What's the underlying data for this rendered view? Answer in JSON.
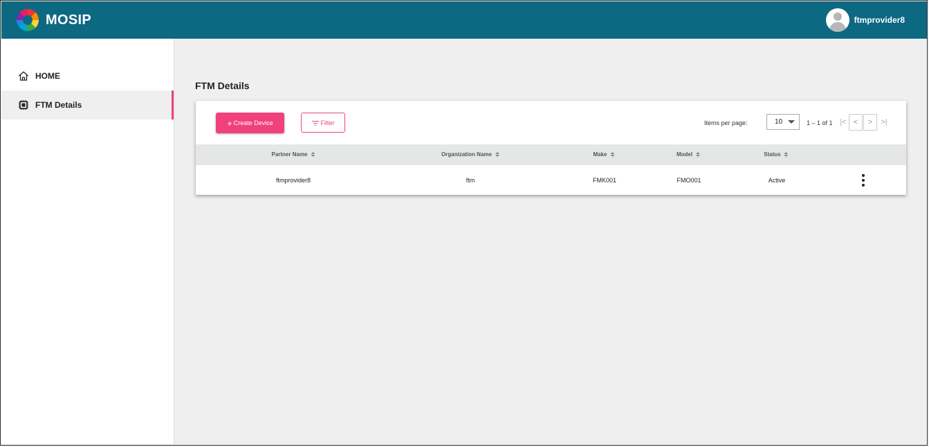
{
  "header": {
    "app_name": "MOSIP",
    "username": "ftmprovider8"
  },
  "sidebar": {
    "items": [
      {
        "label": "HOME",
        "icon": "home-icon"
      },
      {
        "label": "FTM Details",
        "icon": "chip-icon",
        "active": true
      }
    ]
  },
  "main": {
    "title": "FTM Details",
    "create_button": "Create Device",
    "filter_button": "Filter",
    "items_per_page_label": "Items per page:",
    "items_per_page_value": "10",
    "range_label": "1 – 1 of 1",
    "columns": [
      "Partner Name",
      "Organization Name",
      "Make",
      "Model",
      "Status"
    ],
    "rows": [
      {
        "partner_name": "ftmprovider8",
        "organization_name": "ftm",
        "make": "FMK001",
        "model": "FMO001",
        "status": "Active"
      }
    ]
  },
  "colors": {
    "header": "#0d6882",
    "accent": "#f0417c",
    "background": "#efefef"
  }
}
